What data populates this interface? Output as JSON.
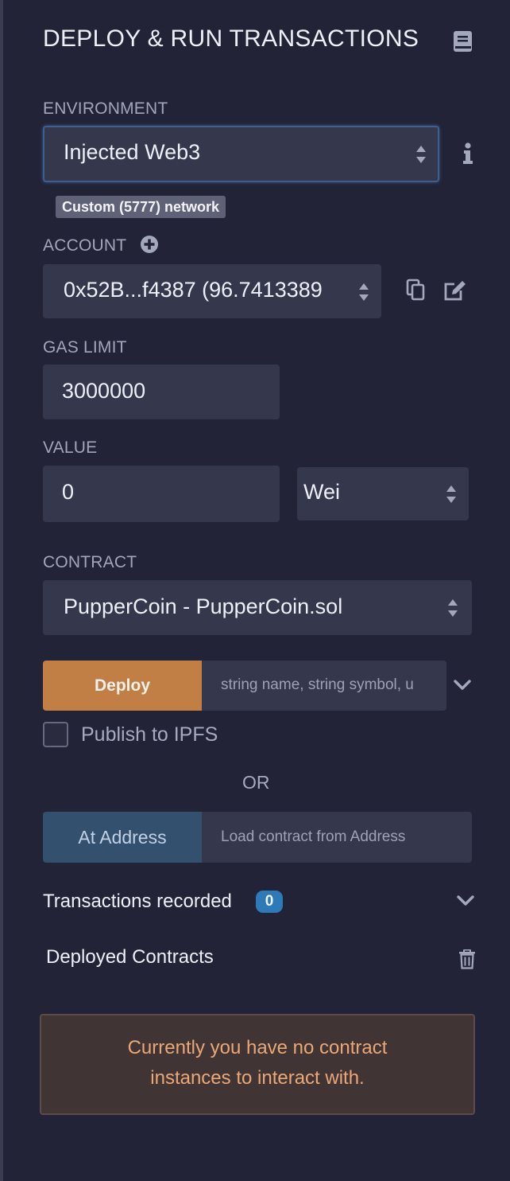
{
  "panel": {
    "title": "DEPLOY & RUN TRANSACTIONS",
    "doc_icon": "book-icon"
  },
  "environment": {
    "label": "ENVIRONMENT",
    "value": "Injected Web3",
    "network_badge": "Custom (5777) network",
    "info_icon": "info-icon"
  },
  "account": {
    "label": "ACCOUNT",
    "value": "0x52B...f4387 (96.7413389",
    "add_icon": "plus-circle-icon",
    "copy_icon": "copy-icon",
    "edit_icon": "edit-icon"
  },
  "gas_limit": {
    "label": "GAS LIMIT",
    "value": "3000000"
  },
  "value_field": {
    "label": "VALUE",
    "amount": "0",
    "unit": "Wei"
  },
  "contract": {
    "label": "CONTRACT",
    "value": "PupperCoin - PupperCoin.sol"
  },
  "deploy": {
    "button_label": "Deploy",
    "args_placeholder": "string name, string symbol, u",
    "expand_icon": "chevron-down-icon"
  },
  "publish": {
    "label": "Publish to IPFS",
    "checked": false
  },
  "or_text": "OR",
  "at_address": {
    "button_label": "At Address",
    "placeholder": "Load contract from Address"
  },
  "transactions": {
    "label": "Transactions recorded",
    "count": "0"
  },
  "deployed": {
    "label": "Deployed Contracts",
    "trash_icon": "trash-icon"
  },
  "notice": {
    "line1": "Currently you have no contract",
    "line2": "instances to interact with."
  },
  "colors": {
    "background": "#222336",
    "field": "#35374d",
    "deploy": "#c17f45",
    "at_address": "#34506f",
    "badge": "#2e79b7",
    "notice_text": "#eba877"
  }
}
